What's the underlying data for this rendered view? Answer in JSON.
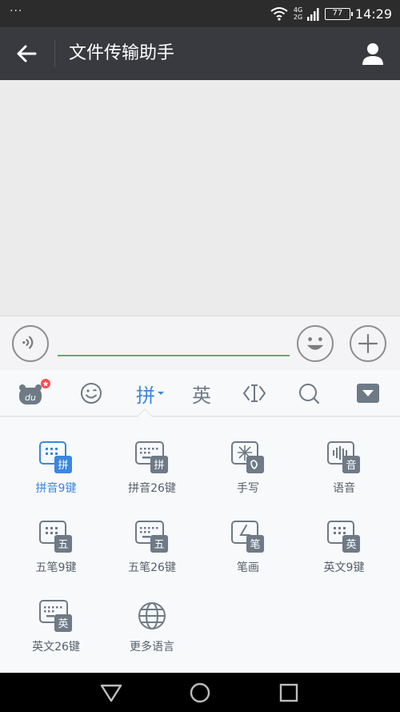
{
  "status_bar": {
    "dots": "···",
    "network_top": "4G",
    "network_bottom": "2G",
    "battery": "77",
    "time": "14:29"
  },
  "header": {
    "title": "文件传输助手"
  },
  "input_bar": {
    "text_value": "",
    "accent_color": "#5ab35a"
  },
  "ime_toolbar": {
    "pinyin_label": "拼",
    "english_label": "英",
    "active_color": "#3b86e0"
  },
  "ime_options": [
    {
      "label": "拼音9键",
      "badge": "拼",
      "active": true
    },
    {
      "label": "拼音26键",
      "badge": "拼",
      "active": false
    },
    {
      "label": "手写",
      "badge": "",
      "active": false
    },
    {
      "label": "语音",
      "badge": "音",
      "active": false
    },
    {
      "label": "五笔9键",
      "badge": "五",
      "active": false
    },
    {
      "label": "五笔26键",
      "badge": "五",
      "active": false
    },
    {
      "label": "笔画",
      "badge": "笔",
      "active": false
    },
    {
      "label": "英文9键",
      "badge": "英",
      "active": false
    },
    {
      "label": "英文26键",
      "badge": "英",
      "active": false
    },
    {
      "label": "更多语言",
      "badge": "",
      "active": false
    }
  ],
  "icons": {
    "back": "arrow-left-icon",
    "profile": "user-icon",
    "voice": "voice-icon",
    "emoji": "emoji-icon",
    "plus": "plus-icon",
    "nav_back": "triangle-back-icon",
    "nav_home": "circle-home-icon",
    "nav_recent": "square-recent-icon"
  }
}
